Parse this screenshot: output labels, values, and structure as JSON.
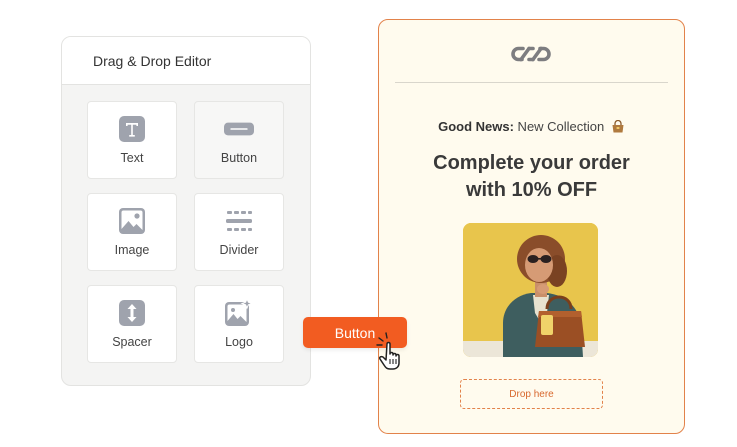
{
  "editor": {
    "title": "Drag & Drop Editor",
    "tiles": [
      {
        "label": "Text",
        "icon": "text-icon"
      },
      {
        "label": "Button",
        "icon": "button-icon"
      },
      {
        "label": "Image",
        "icon": "image-icon"
      },
      {
        "label": "Divider",
        "icon": "divider-icon"
      },
      {
        "label": "Spacer",
        "icon": "spacer-icon"
      },
      {
        "label": "Logo",
        "icon": "logo-icon"
      }
    ]
  },
  "dragging": {
    "label": "Button",
    "icon": "hand-pointer-icon",
    "color": "#f25c21"
  },
  "email": {
    "logo_icon": "chain-link-logo",
    "kicker_bold": "Good News:",
    "kicker_text": " New Collection",
    "kicker_icon": "handbag-emoji",
    "headline_line1": "Complete your order",
    "headline_line2": "with 10% OFF",
    "photo": "woman-with-handbag-photo",
    "drop_label": "Drop here",
    "accent": "#e2824a",
    "background": "#fffbee"
  }
}
